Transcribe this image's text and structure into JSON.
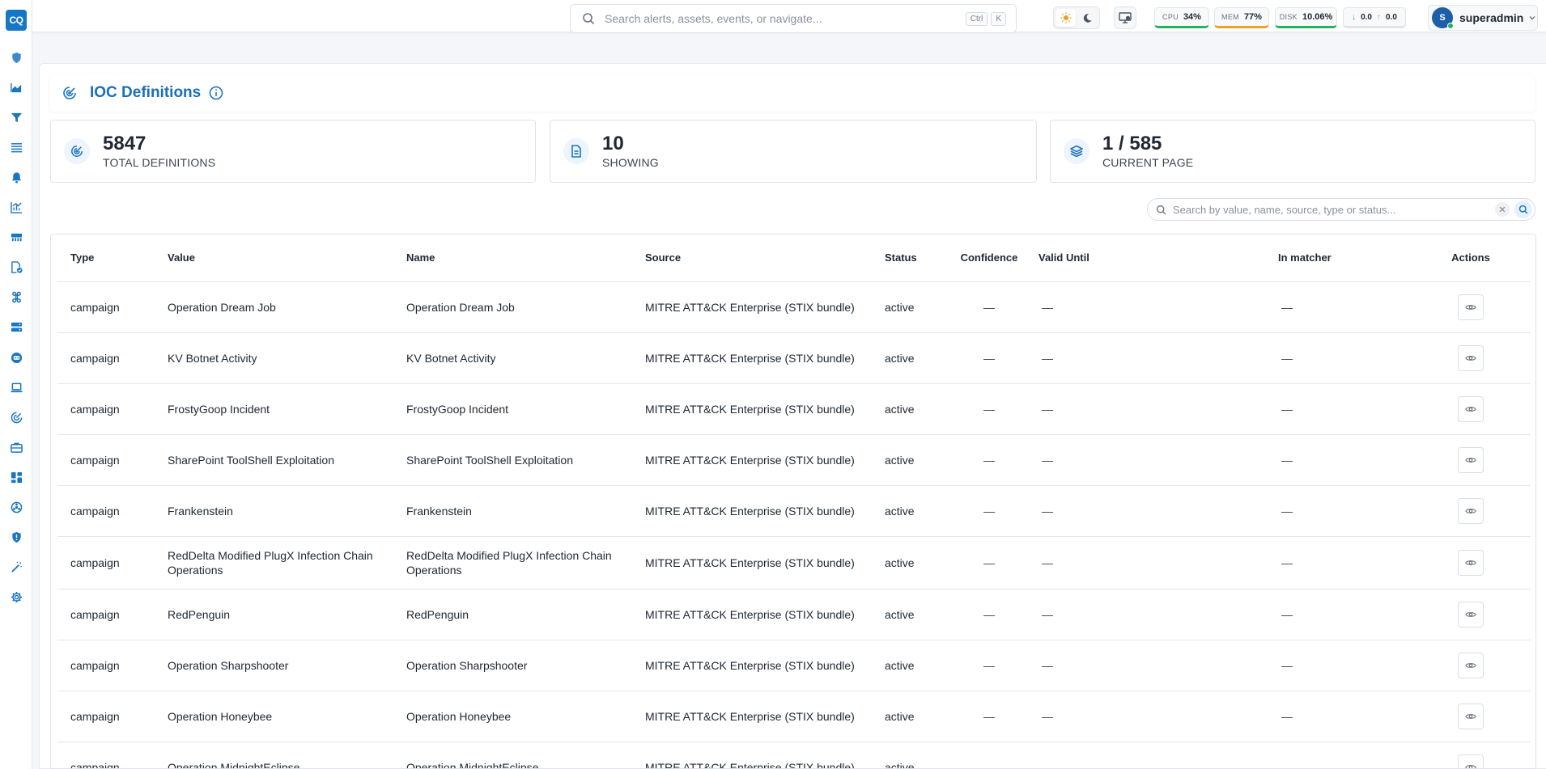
{
  "app": {
    "logo_text": "CQ"
  },
  "sidebar": {
    "items": [
      {
        "icon": "shield-icon"
      },
      {
        "icon": "area-chart-icon"
      },
      {
        "icon": "filter-icon"
      },
      {
        "icon": "list-icon"
      },
      {
        "icon": "bell-icon"
      },
      {
        "icon": "bar-chart-icon"
      },
      {
        "icon": "cluster-icon"
      },
      {
        "icon": "file-check-icon"
      },
      {
        "icon": "command-icon"
      },
      {
        "icon": "server-icon"
      },
      {
        "icon": "robot-icon"
      },
      {
        "icon": "laptop-icon"
      },
      {
        "icon": "radar-icon"
      },
      {
        "icon": "briefcase-icon"
      },
      {
        "icon": "dashboard-icon"
      },
      {
        "icon": "biohazard-icon"
      },
      {
        "icon": "shield-alert-icon"
      },
      {
        "icon": "magic-wand-icon"
      },
      {
        "icon": "gear-icon"
      }
    ]
  },
  "topbar": {
    "search_placeholder": "Search alerts, assets, events, or navigate...",
    "kbd_ctrl": "Ctrl",
    "kbd_k": "K",
    "cpu": {
      "label": "CPU",
      "value": "34%",
      "color": "#22b35e"
    },
    "mem": {
      "label": "MEM",
      "value": "77%",
      "color": "#f0a020"
    },
    "disk": {
      "label": "DISK",
      "value": "10.06%",
      "color": "#22b35e"
    },
    "net": {
      "down": "0.0",
      "up": "0.0"
    },
    "user": {
      "initial": "S",
      "name": "superadmin"
    }
  },
  "page": {
    "title": "IOC Definitions",
    "stats": [
      {
        "value": "5847",
        "caption": "TOTAL DEFINITIONS"
      },
      {
        "value": "10",
        "caption": "SHOWING"
      },
      {
        "value": "1 / 585",
        "caption": "CURRENT PAGE"
      }
    ],
    "filter_placeholder": "Search by value, name, source, type or status..."
  },
  "table": {
    "columns": [
      "Type",
      "Value",
      "Name",
      "Source",
      "Status",
      "Confidence",
      "Valid Until",
      "In matcher",
      "Actions"
    ],
    "rows": [
      {
        "type": "campaign",
        "value": "Operation Dream Job",
        "name": "Operation Dream Job",
        "source": "MITRE ATT&CK Enterprise (STIX bundle)",
        "status": "active",
        "confidence": "—",
        "valid_until": "—",
        "in_matcher": "—"
      },
      {
        "type": "campaign",
        "value": "KV Botnet Activity",
        "name": "KV Botnet Activity",
        "source": "MITRE ATT&CK Enterprise (STIX bundle)",
        "status": "active",
        "confidence": "—",
        "valid_until": "—",
        "in_matcher": "—"
      },
      {
        "type": "campaign",
        "value": "FrostyGoop Incident",
        "name": "FrostyGoop Incident",
        "source": "MITRE ATT&CK Enterprise (STIX bundle)",
        "status": "active",
        "confidence": "—",
        "valid_until": "—",
        "in_matcher": "—"
      },
      {
        "type": "campaign",
        "value": "SharePoint ToolShell Exploitation",
        "name": "SharePoint ToolShell Exploitation",
        "source": "MITRE ATT&CK Enterprise (STIX bundle)",
        "status": "active",
        "confidence": "—",
        "valid_until": "—",
        "in_matcher": "—"
      },
      {
        "type": "campaign",
        "value": "Frankenstein",
        "name": "Frankenstein",
        "source": "MITRE ATT&CK Enterprise (STIX bundle)",
        "status": "active",
        "confidence": "—",
        "valid_until": "—",
        "in_matcher": "—"
      },
      {
        "type": "campaign",
        "value": "RedDelta Modified PlugX Infection Chain Operations",
        "name": "RedDelta Modified PlugX Infection Chain Operations",
        "source": "MITRE ATT&CK Enterprise (STIX bundle)",
        "status": "active",
        "confidence": "—",
        "valid_until": "—",
        "in_matcher": "—"
      },
      {
        "type": "campaign",
        "value": "RedPenguin",
        "name": "RedPenguin",
        "source": "MITRE ATT&CK Enterprise (STIX bundle)",
        "status": "active",
        "confidence": "—",
        "valid_until": "—",
        "in_matcher": "—"
      },
      {
        "type": "campaign",
        "value": "Operation Sharpshooter",
        "name": "Operation Sharpshooter",
        "source": "MITRE ATT&CK Enterprise (STIX bundle)",
        "status": "active",
        "confidence": "—",
        "valid_until": "—",
        "in_matcher": "—"
      },
      {
        "type": "campaign",
        "value": "Operation Honeybee",
        "name": "Operation Honeybee",
        "source": "MITRE ATT&CK Enterprise (STIX bundle)",
        "status": "active",
        "confidence": "—",
        "valid_until": "—",
        "in_matcher": "—"
      },
      {
        "type": "campaign",
        "value": "Operation MidnightEclipse",
        "name": "Operation MidnightEclipse",
        "source": "MITRE ATT&CK Enterprise (STIX bundle)",
        "status": "active",
        "confidence": "—",
        "valid_until": "—",
        "in_matcher": "—"
      }
    ]
  }
}
